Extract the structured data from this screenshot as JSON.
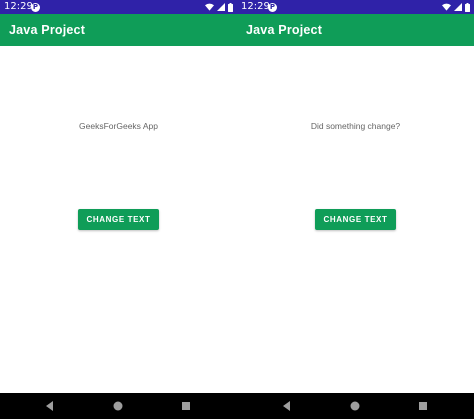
{
  "colors": {
    "status_bar": "#2f22a8",
    "app_bar": "#0f9d58",
    "button": "#0f9d58",
    "nav_bar": "#000000",
    "content_text": "#666666"
  },
  "screens": [
    {
      "status": {
        "time": "12:29",
        "notification_icon": "app-notification-icon",
        "icons": [
          "wifi-icon",
          "signal-icon",
          "battery-icon"
        ]
      },
      "app_title": "Java Project",
      "text": "GeeksForGeeks App",
      "button_label": "CHANGE TEXT",
      "nav": [
        "back-icon",
        "home-icon",
        "recents-icon"
      ]
    },
    {
      "status": {
        "time": "12:29",
        "notification_icon": "app-notification-icon",
        "icons": [
          "wifi-icon",
          "signal-icon",
          "battery-icon"
        ]
      },
      "app_title": "Java Project",
      "text": "Did something change?",
      "button_label": "CHANGE TEXT",
      "nav": [
        "back-icon",
        "home-icon",
        "recents-icon"
      ]
    }
  ]
}
